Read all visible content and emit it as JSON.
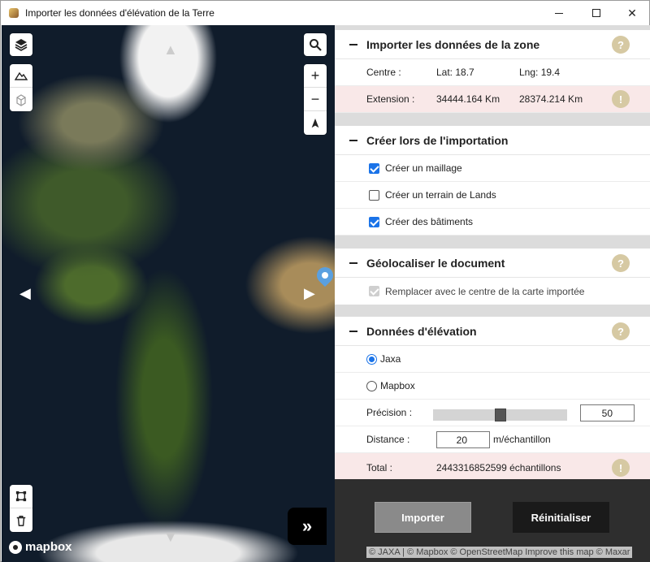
{
  "window": {
    "title": "Importer les données d'élévation de la Terre",
    "minimize_icon": "minimize-icon",
    "maximize_icon": "maximize-icon",
    "close_glyph": "✕"
  },
  "map": {
    "nav_left": "◀",
    "nav_right": "▶",
    "nav_up": "▲",
    "nav_down": "▼",
    "zoom_in": "+",
    "zoom_out": "−",
    "expand": "»",
    "logo_text": "mapbox",
    "attribution": "© JAXA | © Mapbox © OpenStreetMap Improve this map © Maxar"
  },
  "section_import": {
    "title": "Importer les données de la zone",
    "help": "?",
    "center_label": "Centre :",
    "lat": "Lat: 18.7",
    "lng": "Lng: 19.4",
    "extent_label": "Extension :",
    "extent_x": "34444.164 Km",
    "extent_y": "28374.214 Km",
    "warn": "!"
  },
  "section_create": {
    "title": "Créer lors de l'importation",
    "items": [
      {
        "label": "Créer un maillage",
        "checked": true
      },
      {
        "label": "Créer un terrain de Lands",
        "checked": false
      },
      {
        "label": "Créer des bâtiments",
        "checked": true
      }
    ]
  },
  "section_geo": {
    "title": "Géolocaliser le document",
    "help": "?",
    "replace_label": "Remplacer avec le centre de la carte importée"
  },
  "section_elev": {
    "title": "Données d'élévation",
    "help": "?",
    "source_jaxa": "Jaxa",
    "source_mapbox": "Mapbox",
    "precision_label": "Précision :",
    "precision_value": "50",
    "precision_level": 0.5,
    "distance_label": "Distance :",
    "distance_value": "20",
    "distance_unit": "m/échantillon",
    "total_label": "Total :",
    "total_value": "2443316852599 échantillons",
    "warn": "!"
  },
  "footer": {
    "import_label": "Importer",
    "reset_label": "Réinitialiser"
  }
}
